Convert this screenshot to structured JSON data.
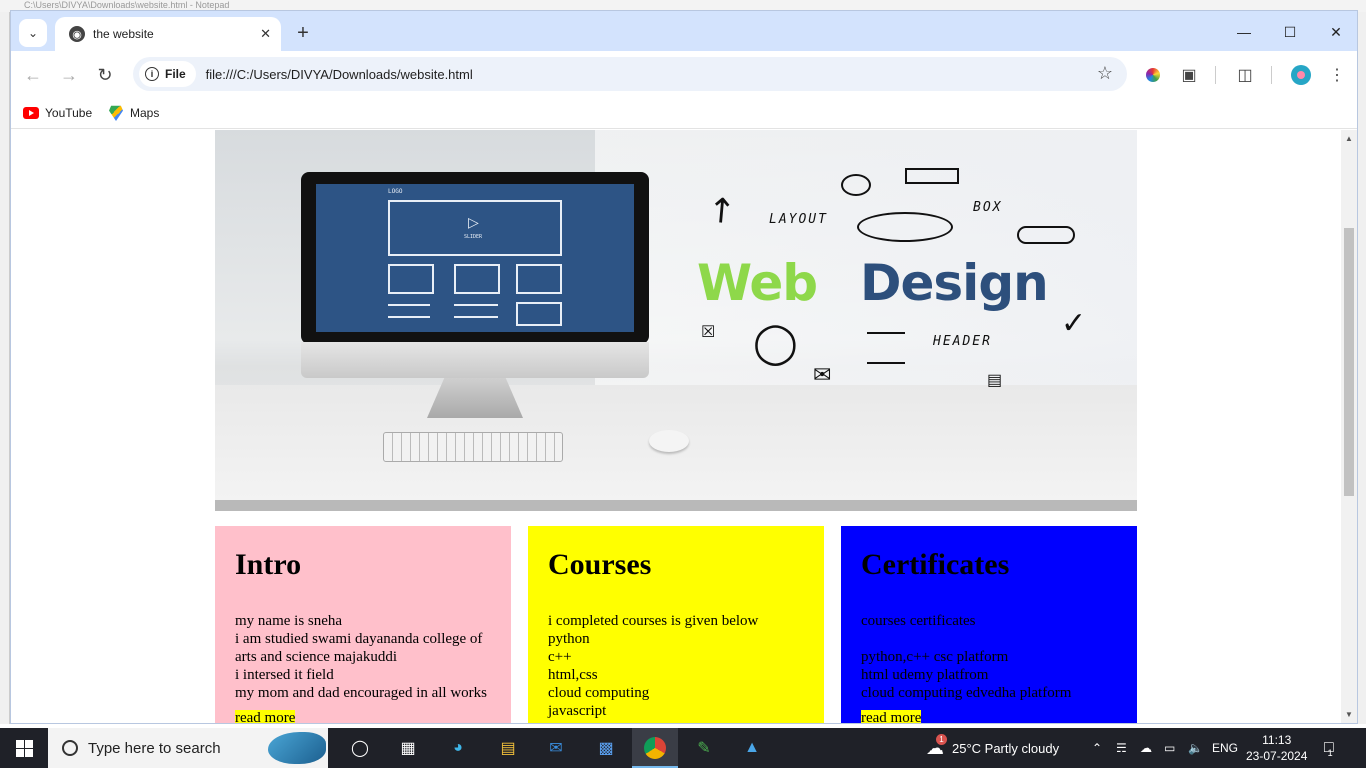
{
  "background_window": {
    "title": "C:\\Users\\DIVYA\\Downloads\\website.html - Notepad"
  },
  "browser": {
    "tab": {
      "title": "the website"
    },
    "address": {
      "chip_label": "File",
      "url": "file:///C:/Users/DIVYA/Downloads/website.html"
    },
    "bookmarks": [
      {
        "label": "YouTube"
      },
      {
        "label": "Maps"
      }
    ]
  },
  "hero": {
    "word_web": "Web",
    "word_design": "Design",
    "sketch_labels": {
      "layout": "LAYOUT",
      "box": "BOX",
      "header": "HEADER",
      "logo": "LOGO",
      "slider": "SLIDER"
    },
    "colors": {
      "web": "#8ed84a",
      "design": "#2d4f7c",
      "screen": "#2d5485"
    }
  },
  "cards": [
    {
      "title": "Intro",
      "lines": [
        "my name is sneha",
        "i am studied swami dayananda college of",
        "arts and science majakuddi",
        "i intersed it field",
        "my mom and dad encouraged in all works"
      ],
      "button": "read more",
      "color": "#ffc0cb"
    },
    {
      "title": "Courses",
      "lines": [
        "i completed courses is given below",
        "python",
        "c++",
        "html,css",
        "cloud computing",
        "javascript"
      ],
      "color": "#ffff00"
    },
    {
      "title": "Certificates",
      "lines": [
        "courses certificates",
        "",
        "python,c++ csc platform",
        "html udemy platfrom",
        "cloud computing edvedha platform"
      ],
      "button": "read more",
      "color": "#0000ff"
    }
  ],
  "taskbar": {
    "search_placeholder": "Type here to search",
    "weather": "25°C  Partly cloudy",
    "language": "ENG",
    "time": "11:13",
    "date": "23-07-2024",
    "notification_count": "1",
    "weather_badge": "1"
  }
}
